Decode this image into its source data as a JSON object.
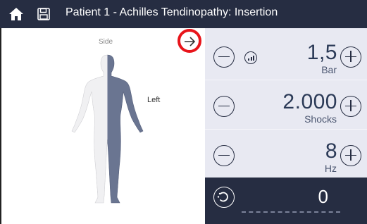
{
  "header": {
    "title": "Patient 1 - Achilles Tendinopathy: Insertion",
    "icons": [
      "home-icon",
      "save-icon"
    ]
  },
  "body_map": {
    "side_label": "Side",
    "left_label": "Left",
    "selected_side": "left"
  },
  "controls": {
    "pressure": {
      "value": "1,5",
      "unit": "Bar"
    },
    "shocks": {
      "value": "2.000",
      "unit": "Shocks"
    },
    "frequency": {
      "value": "8",
      "unit": "Hz"
    }
  },
  "counter": {
    "value": "0"
  },
  "colors": {
    "header_bg": "#262d42",
    "panel_bg": "#e8e9f2",
    "highlight_ring": "#e8141a",
    "text_dark": "#2b3a57"
  }
}
